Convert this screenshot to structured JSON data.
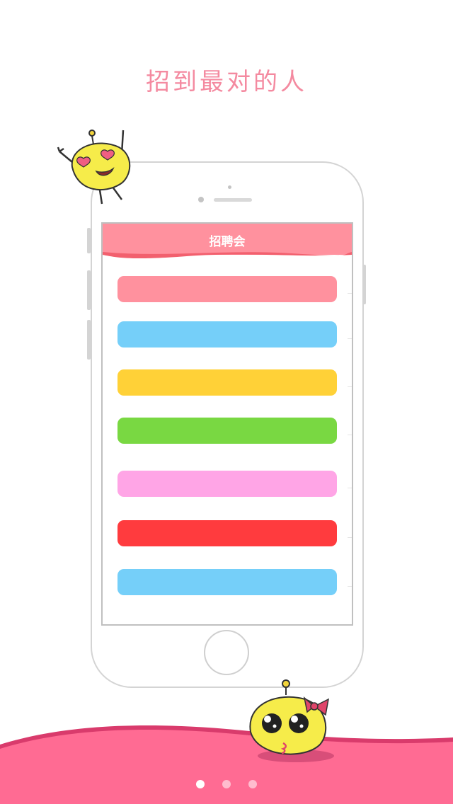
{
  "headline": "招到最对的人",
  "app": {
    "nav_title": "招聘会"
  },
  "colors": {
    "headline": "#f48aa0",
    "nav": "#ff919e",
    "nav_wave": "#f2606e",
    "ground": "#ff6b93",
    "ground_edge": "#d93b6c"
  },
  "bars": [
    {
      "color": "#ff919e"
    },
    {
      "color": "#75cff9"
    },
    {
      "color": "#ffd137"
    },
    {
      "color": "#79d842"
    },
    {
      "color": "#ffa5e6"
    },
    {
      "color": "#ff3b3e"
    },
    {
      "color": "#75cff9"
    }
  ],
  "pagination": {
    "count": 3,
    "active_index": 0
  },
  "mascots": [
    {
      "name": "heart-eyes-mascot-icon"
    },
    {
      "name": "bow-mascot-icon"
    }
  ]
}
